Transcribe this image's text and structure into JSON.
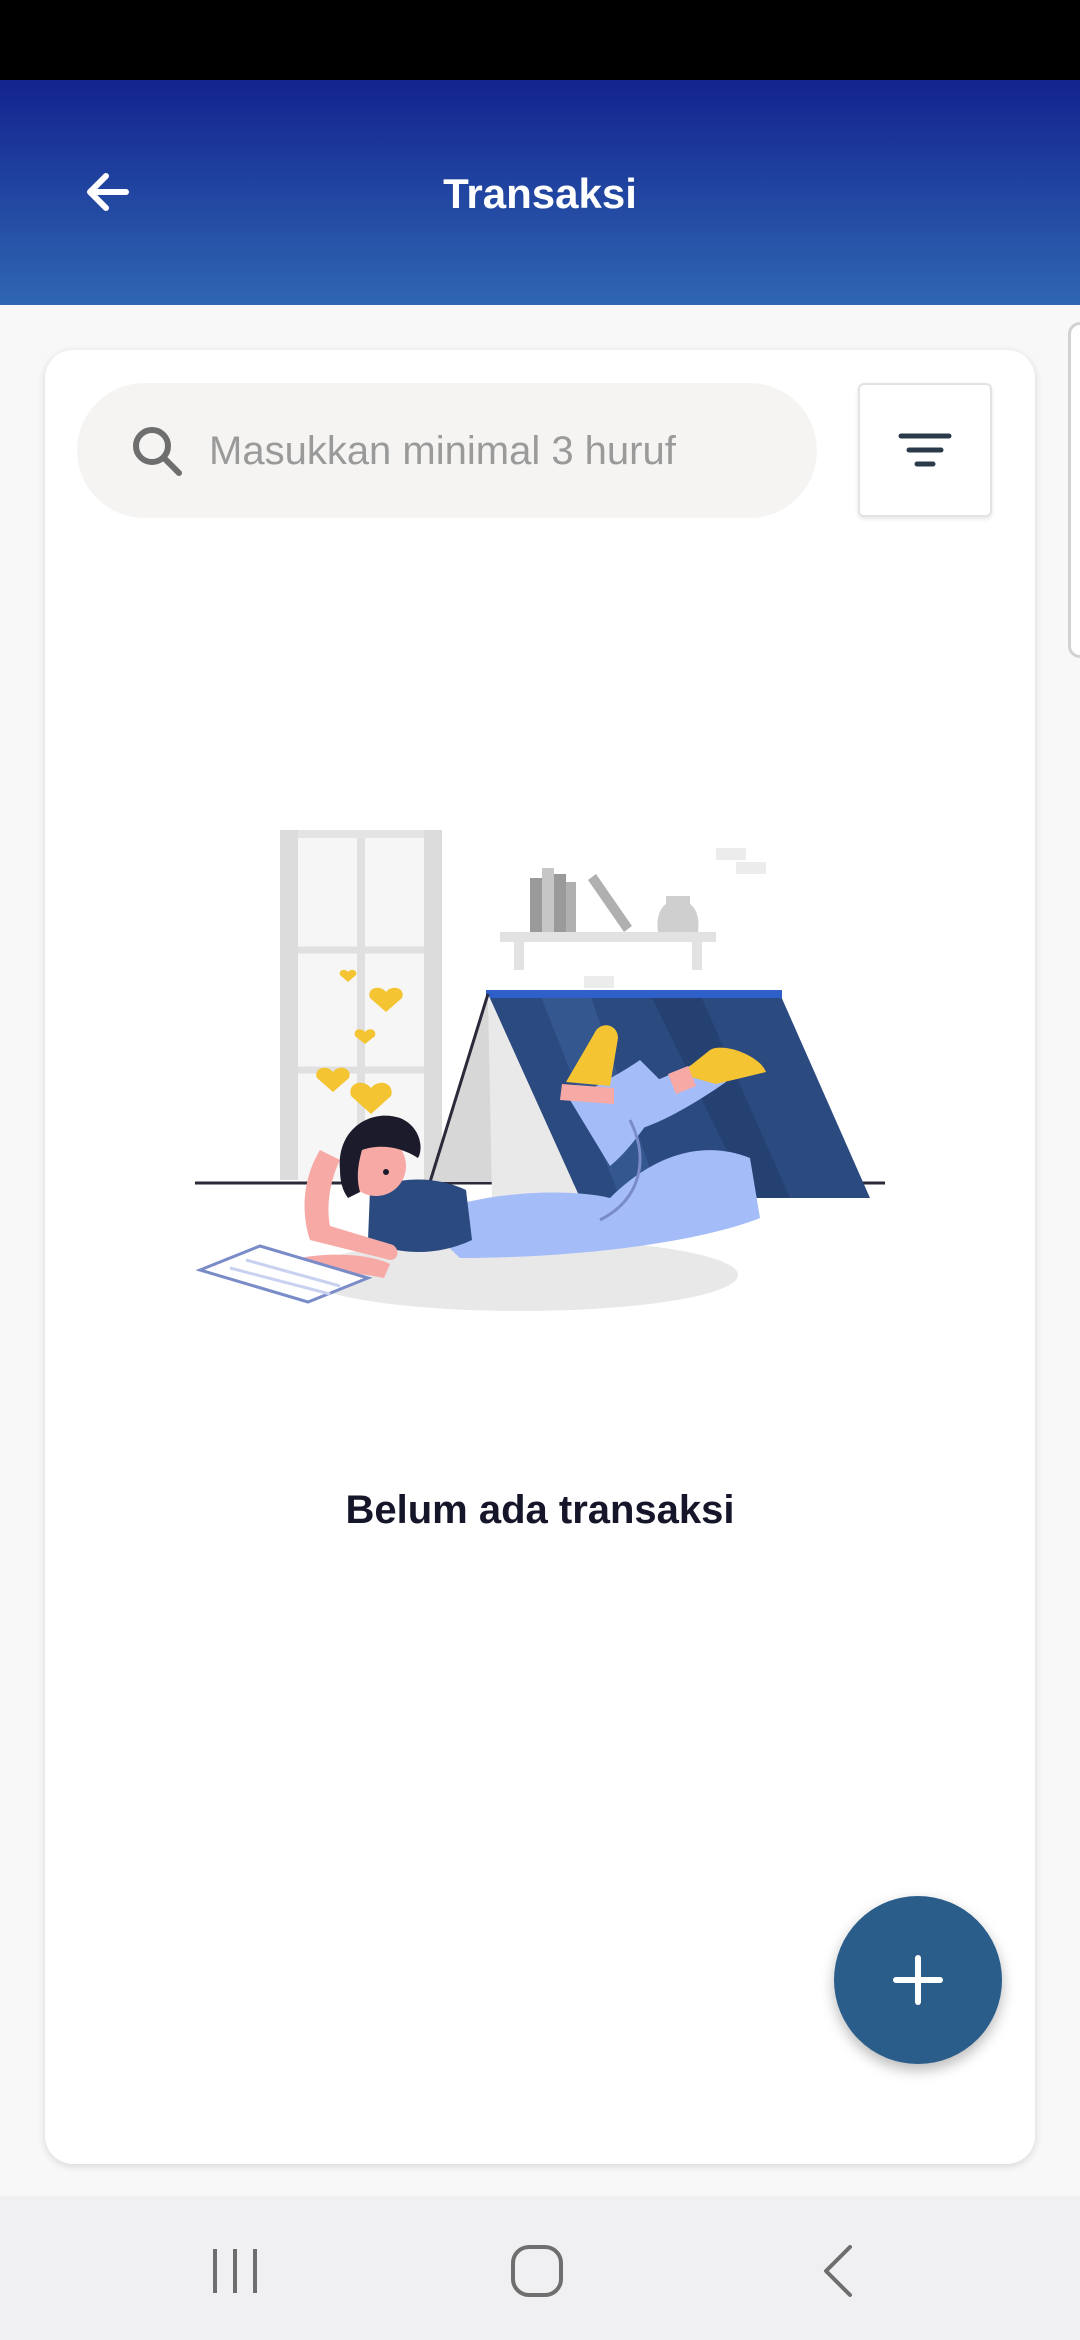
{
  "header": {
    "title": "Transaksi",
    "background_top": "#13238f",
    "background_bottom": "#2f67b2"
  },
  "search": {
    "placeholder": "Masukkan minimal 3 huruf",
    "value": ""
  },
  "empty_state": {
    "message": "Belum ada transaksi"
  },
  "icons": {
    "back": "arrow-left-icon",
    "search": "search-icon",
    "filter": "filter-icon",
    "add": "plus-icon",
    "nav_recents": "recent-apps-icon",
    "nav_home": "home-icon",
    "nav_back": "back-chevron-icon"
  },
  "colors": {
    "accent": "#2a5d8a",
    "tent": "#2b4a80",
    "person_pants": "#a4bcf8",
    "socks": "#f4c432"
  }
}
